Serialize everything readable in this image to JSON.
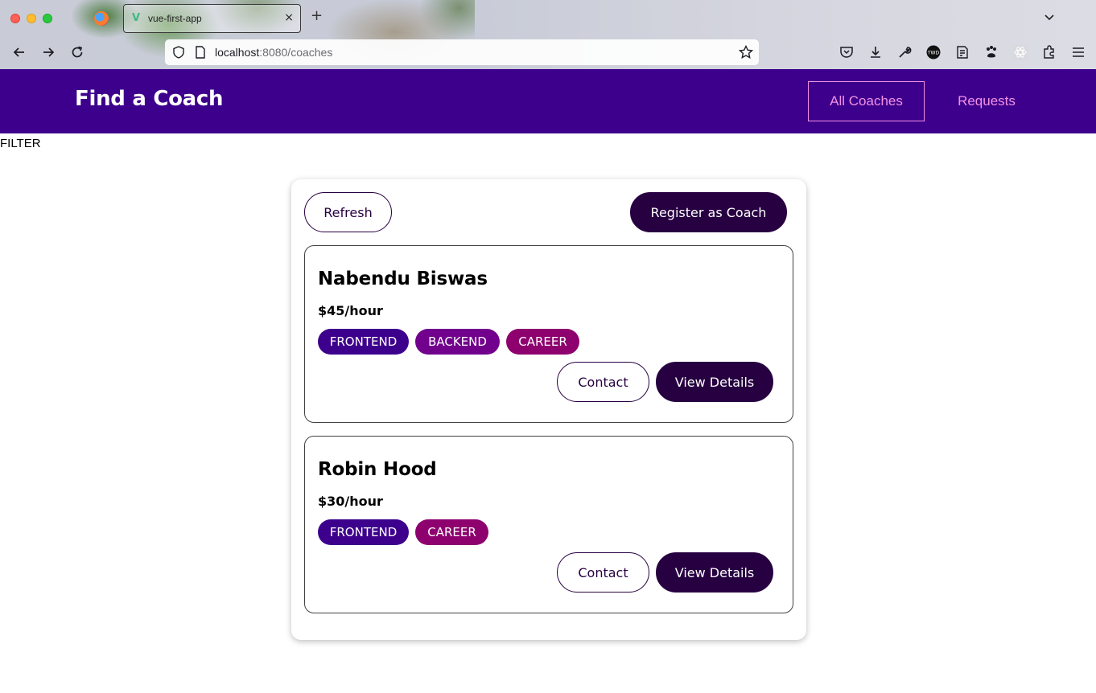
{
  "browser": {
    "tab_title": "vue-first-app",
    "tab_close": "×",
    "new_tab": "+",
    "url_host": "localhost",
    "url_rest": ":8080/coaches"
  },
  "header": {
    "brand": "Find a Coach",
    "nav": [
      {
        "label": "All Coaches",
        "active": true
      },
      {
        "label": "Requests",
        "active": false
      }
    ]
  },
  "filter": {
    "label": "FILTER"
  },
  "controls": {
    "refresh_label": "Refresh",
    "register_label": "Register as Coach"
  },
  "coaches": [
    {
      "name": "Nabendu Biswas",
      "rate": "$45/hour",
      "areas": [
        "FRONTEND",
        "BACKEND",
        "CAREER"
      ],
      "contact_label": "Contact",
      "details_label": "View Details"
    },
    {
      "name": "Robin Hood",
      "rate": "$30/hour",
      "areas": [
        "FRONTEND",
        "CAREER"
      ],
      "contact_label": "Contact",
      "details_label": "View Details"
    }
  ],
  "colors": {
    "header_bg": "#3d008d",
    "nav_link": "#f391e3",
    "button_dark": "#270041",
    "badge_frontend": "#3d008d",
    "badge_backend": "#71008d",
    "badge_career": "#8d006e"
  }
}
